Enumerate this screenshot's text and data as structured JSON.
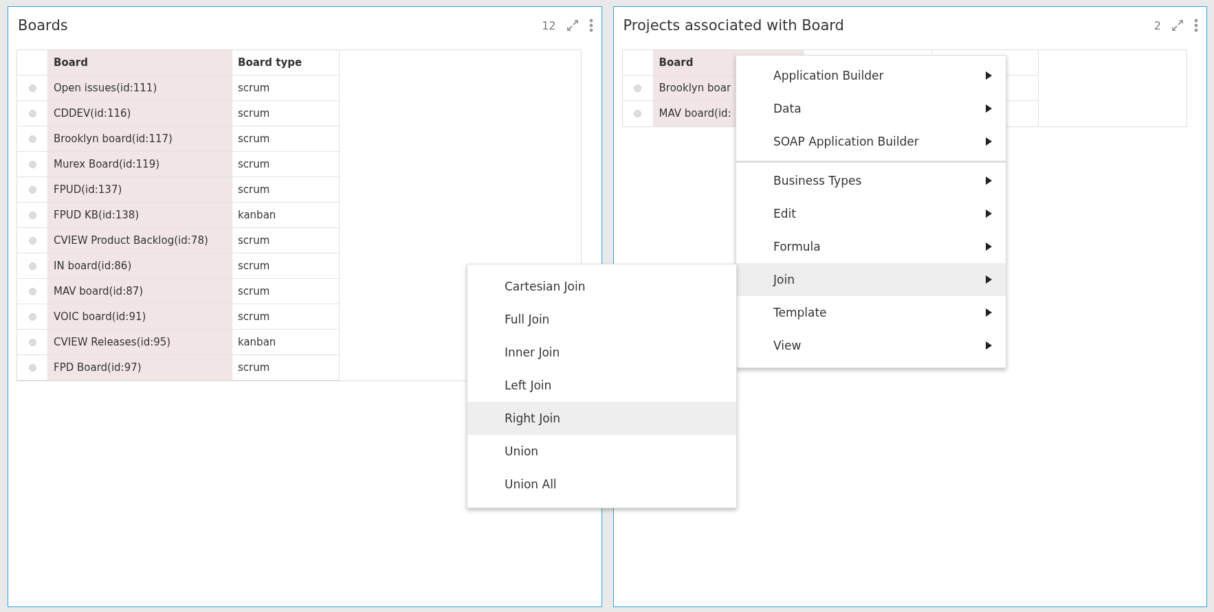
{
  "panels": [
    {
      "title": "Boards",
      "count": "12",
      "table": {
        "columns": [
          "Board",
          "Board type"
        ],
        "rows": [
          {
            "cells": [
              "Open issues(id:111)",
              "scrum"
            ],
            "selected": false
          },
          {
            "cells": [
              "CDDEV(id:116)",
              "scrum"
            ],
            "selected": false
          },
          {
            "cells": [
              "Brooklyn board(id:117)",
              "scrum"
            ],
            "selected": false
          },
          {
            "cells": [
              "Murex Board(id:119)",
              "scrum"
            ],
            "selected": false
          },
          {
            "cells": [
              "FPUD(id:137)",
              "scrum"
            ],
            "selected": false
          },
          {
            "cells": [
              "FPUD KB(id:138)",
              "kanban"
            ],
            "selected": false
          },
          {
            "cells": [
              "CVIEW Product Backlog(id:78)",
              "scrum"
            ],
            "selected": false
          },
          {
            "cells": [
              "IN board(id:86)",
              "scrum"
            ],
            "selected": false
          },
          {
            "cells": [
              "MAV board(id:87)",
              "scrum"
            ],
            "selected": false
          },
          {
            "cells": [
              "VOIC board(id:91)",
              "scrum"
            ],
            "selected": false
          },
          {
            "cells": [
              "CVIEW Releases(id:95)",
              "kanban"
            ],
            "selected": false
          },
          {
            "cells": [
              "FPD Board(id:97)",
              "scrum"
            ],
            "selected": false
          }
        ]
      }
    },
    {
      "title": "Projects associated with Board",
      "count": "2",
      "table": {
        "columns": [
          "Board"
        ],
        "rows": [
          {
            "cells": [
              "Brooklyn boar"
            ],
            "selected": false
          },
          {
            "cells": [
              "MAV board(id:"
            ],
            "selected": false
          }
        ]
      }
    }
  ],
  "context_menu": {
    "groups": [
      [
        {
          "label": "Application Builder",
          "selected": false
        },
        {
          "label": "Data",
          "selected": false
        },
        {
          "label": "SOAP Application Builder",
          "selected": false
        }
      ],
      [
        {
          "label": "Business Types",
          "selected": false
        },
        {
          "label": "Edit",
          "selected": false
        },
        {
          "label": "Formula",
          "selected": false
        },
        {
          "label": "Join",
          "selected": true
        },
        {
          "label": "Template",
          "selected": false
        },
        {
          "label": "View",
          "selected": false
        }
      ]
    ]
  },
  "submenu": {
    "items": [
      {
        "label": "Cartesian Join",
        "selected": false
      },
      {
        "label": "Full Join",
        "selected": false
      },
      {
        "label": "Inner Join",
        "selected": false
      },
      {
        "label": "Left Join",
        "selected": false
      },
      {
        "label": "Right Join",
        "selected": true
      },
      {
        "label": "Union",
        "selected": false
      },
      {
        "label": "Union All",
        "selected": false
      }
    ]
  }
}
